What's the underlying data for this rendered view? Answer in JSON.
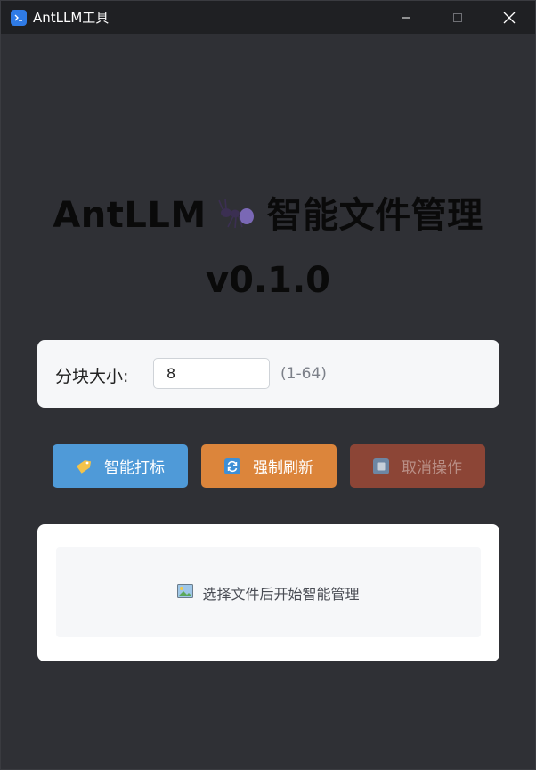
{
  "window": {
    "title": "AntLLM工具"
  },
  "header": {
    "title_prefix": "AntLLM",
    "title_suffix": "智能文件管理",
    "version": "v0.1.0",
    "ant_icon": "ant-icon"
  },
  "settings": {
    "chunk_label": "分块大小:",
    "chunk_value": "8",
    "chunk_range": "(1-64)"
  },
  "actions": {
    "tag_label": "智能打标",
    "refresh_label": "强制刷新",
    "cancel_label": "取消操作"
  },
  "status": {
    "message": "选择文件后开始智能管理",
    "icon": "picture-icon"
  },
  "colors": {
    "tag_button": "#4f9ad8",
    "refresh_button": "#dc853b",
    "cancel_button": "#8c4536"
  }
}
